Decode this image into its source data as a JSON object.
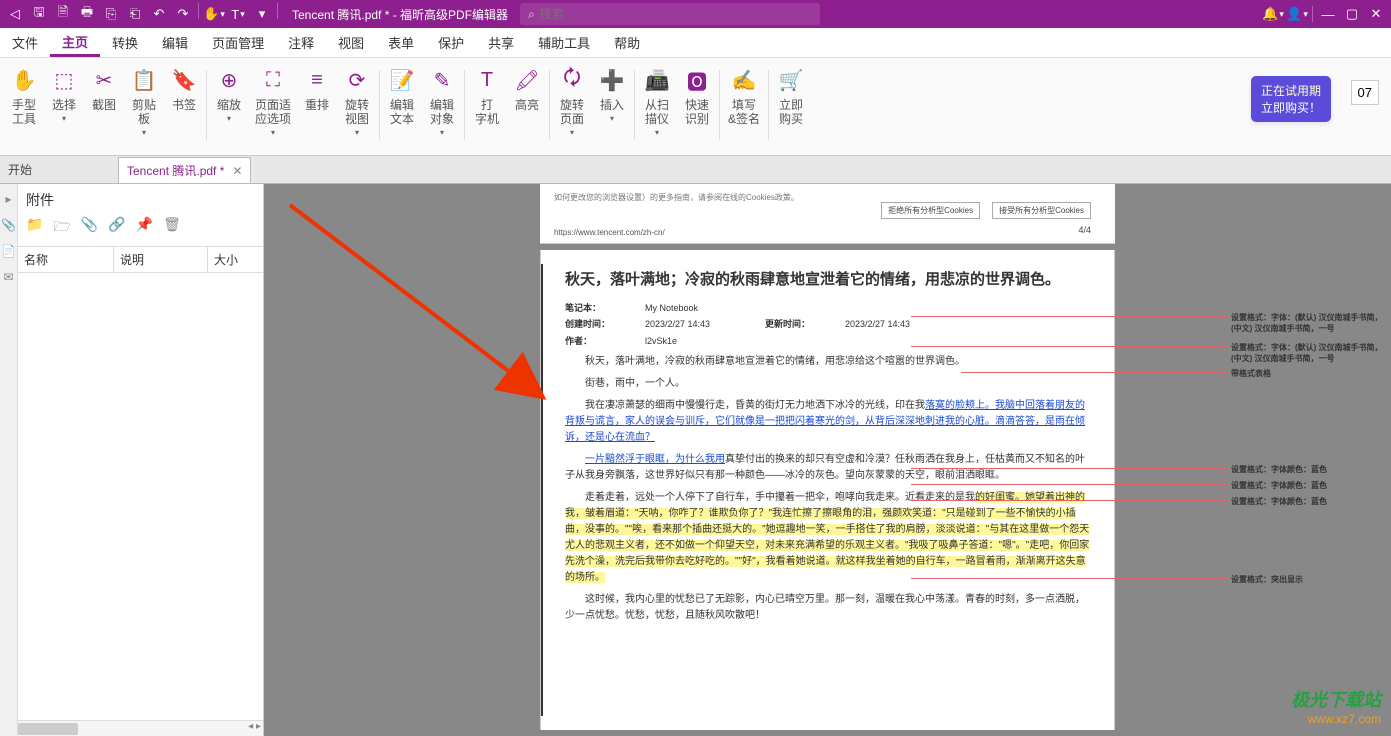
{
  "title_bar": {
    "filename": "Tencent 腾讯.pdf * - 福昕高级PDF编辑器",
    "search_placeholder": "搜索",
    "icons": [
      "back",
      "save",
      "undo",
      "redo",
      "print",
      "export-pdf",
      "export-doc",
      "rotate",
      "hand",
      "font"
    ]
  },
  "menu": {
    "items": [
      "文件",
      "主页",
      "转换",
      "编辑",
      "页面管理",
      "注释",
      "视图",
      "表单",
      "保护",
      "共享",
      "辅助工具",
      "帮助"
    ],
    "active_index": 1
  },
  "ribbon": {
    "groups": [
      {
        "label": "手型\n工具",
        "dd": false
      },
      {
        "label": "选择",
        "dd": true
      },
      {
        "label": "截图",
        "dd": false
      },
      {
        "label": "剪贴\n板",
        "dd": true
      },
      {
        "label": "书签",
        "dd": false
      },
      {
        "label": "缩放",
        "dd": true
      },
      {
        "label": "页面适\n应选项",
        "dd": true
      },
      {
        "label": "重排",
        "dd": false
      },
      {
        "label": "旋转\n视图",
        "dd": true
      },
      {
        "label": "编辑\n文本",
        "dd": false
      },
      {
        "label": "编辑\n对象",
        "dd": true
      },
      {
        "label": "打\n字机",
        "dd": false
      },
      {
        "label": "高亮",
        "dd": false
      },
      {
        "label": "旋转\n页面",
        "dd": true
      },
      {
        "label": "插入",
        "dd": true
      },
      {
        "label": "从扫\n描仪",
        "dd": true
      },
      {
        "label": "快速\n识别",
        "dd": false
      },
      {
        "label": "填写\n&签名",
        "dd": false
      },
      {
        "label": "立即\n购买",
        "dd": false
      }
    ],
    "trial": {
      "line1": "正在试用期",
      "line2": "立即购买！",
      "days": "07"
    }
  },
  "tabs": {
    "start_label": "开始",
    "doc_label": "Tencent 腾讯.pdf *"
  },
  "attachments": {
    "title": "附件",
    "col1": "名称",
    "col2": "说明",
    "col3": "大小"
  },
  "prev_page": {
    "small_text": "如何更改您的浏览器设置）的更多指南，请参阅在线的Cookies政策。",
    "btn1": "拒绝所有分析型Cookies",
    "btn2": "接受所有分析型Cookies",
    "url": "https://www.tencent.com/zh-cn/",
    "page_no": "4/4"
  },
  "doc": {
    "title": "秋天，落叶满地；冷寂的秋雨肆意地宣泄着它的情绪，用悲凉的世界调色。",
    "meta": {
      "notebook_label": "笔记本：",
      "notebook": "My Notebook",
      "created_label": "创建时间：",
      "created": "2023/2/27 14:43",
      "updated_label": "更新时间：",
      "updated": "2023/2/27 14:43",
      "author_label": "作者：",
      "author": "l2vSk1e"
    },
    "p1": "秋天，落叶满地，冷寂的秋雨肆意地宣泄着它的情绪，用悲凉给这个喧嚣的世界调色。",
    "p2": "街巷，雨中，一个人。",
    "p3_a": "我在凄凉萧瑟的细雨中慢慢行走，昏黄的街灯无力地洒下冰冷的光线，印在我",
    "p3_b": "落寞的脸颊上。我脑中回落着朋友的背叛与谎言，家人的误会与训斥，它们就像是一把把闪着寒光的剑，从背后深深地刺进我的心脏。滴滴答答，是雨在倾诉，还是心在流血？",
    "p4_a": "一片黯然浮于眼眶，为什么我用",
    "p4_b": "真挚付出的换来的却只有空虚和冷漠？任秋雨洒在我身上，任枯黄而又不知名的叶子从我身旁飘落，这世界好似只有那一种颜色——冰冷的灰色。望向灰蒙蒙的天空，眼前泪洒眼眶。",
    "p5_a": "走着走着，远处一个人停下了自行车，手中攥着一把伞，咆哮向我走来。近看走来的是我",
    "p5_b": "的好闺蜜。她望着出神的我，皱着眉道：\"天呐，你咋了？谁欺负你了？\"我连忙擦了擦眼角的泪，强颜欢笑道：\"只是碰到了一些不愉快的小插曲，没事的。\"\"唉，看来那个插曲还挺大的。\"她逗趣地一笑，一手搭住了我的肩膀，淡淡说道：\"与其在这里做一个怨天尤人的悲观主义者，还不如做一个仰望天空，对未来充满希望的乐观主义者。\"我吸了吸鼻子答道：\"嗯\"。\"走吧，你回家先洗个澡，洗完后我带你去吃好吃的。\"\"好\"，我看着她说道。就这样我坐着她的自行车，一路冒着雨，渐渐离开这失意的场所。",
    "p6": "这时候，我内心里的忧愁已了无踪影，内心已晴空万里。那一刻，温暖在我心中荡漾。青春的时刻，多一点洒脱，少一点忧愁。忧愁，忧愁，且随秋风吹散吧！"
  },
  "comments": {
    "c1": "设置格式：字体：(默认) 汉仪南城手书简，(中文) 汉仪南城手书简，一号",
    "c2": "设置格式：字体：(默认) 汉仪南城手书简，(中文) 汉仪南城手书简，一号",
    "c3": "带格式表格",
    "c4": "设置格式：字体颜色：蓝色",
    "c5": "设置格式：字体颜色：蓝色",
    "c6": "设置格式：字体颜色：蓝色",
    "c7": "设置格式：突出显示"
  },
  "watermark": {
    "l1": "极光下载站",
    "l2": "www.xz7.com"
  }
}
